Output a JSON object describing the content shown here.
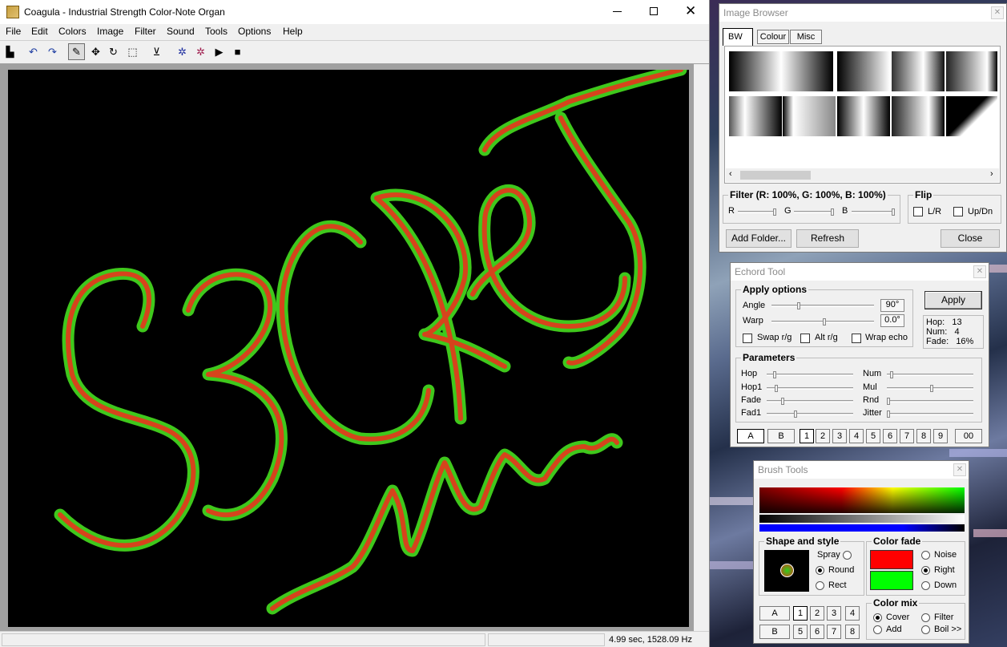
{
  "main_window": {
    "title": "Coagula - Industrial Strength Color-Note Organ",
    "menu": [
      "File",
      "Edit",
      "Colors",
      "Image",
      "Filter",
      "Sound",
      "Tools",
      "Options",
      "Help"
    ],
    "status_text": "4.99 sec, 1528.09 Hz",
    "canvas_text": "S3CRET"
  },
  "image_browser": {
    "title": "Image Browser",
    "tabs": [
      "BW",
      "Colour",
      "Misc"
    ],
    "filter_label": "Filter (R: 100%, G: 100%, B: 100%)",
    "filter_channels": [
      "R",
      "G",
      "B"
    ],
    "flip_label": "Flip",
    "flip_lr": "L/R",
    "flip_updn": "Up/Dn",
    "add_folder": "Add Folder...",
    "refresh": "Refresh",
    "close": "Close"
  },
  "echord_tool": {
    "title": "Echord Tool",
    "apply_options": "Apply options",
    "angle_label": "Angle",
    "angle_value": "90°",
    "warp_label": "Warp",
    "warp_value": "0.0°",
    "swap_rg": "Swap r/g",
    "alt_rg": "Alt r/g",
    "wrap_echo": "Wrap echo",
    "apply": "Apply",
    "info": {
      "hop_label": "Hop:",
      "hop": "13",
      "num_label": "Num:",
      "num": "4",
      "fade_label": "Fade:",
      "fade": "16%"
    },
    "parameters": "Parameters",
    "params_left": [
      "Hop",
      "Hop1",
      "Fade",
      "Fad1"
    ],
    "params_right": [
      "Num",
      "Mul",
      "Rnd",
      "Jitter"
    ],
    "presets": [
      "A",
      "B",
      "1",
      "2",
      "3",
      "4",
      "5",
      "6",
      "7",
      "8",
      "9",
      "00"
    ]
  },
  "brush_tools": {
    "title": "Brush Tools",
    "shape_style": "Shape and style",
    "spray": "Spray",
    "round": "Round",
    "rect": "Rect",
    "color_fade": "Color fade",
    "noise": "Noise",
    "right": "Right",
    "down": "Down",
    "color_mix": "Color mix",
    "cover": "Cover",
    "filter": "Filter",
    "add": "Add",
    "boil": "Boil >>",
    "row_a": [
      "A",
      "1",
      "2",
      "3",
      "4"
    ],
    "row_b": [
      "B",
      "5",
      "6",
      "7",
      "8"
    ],
    "fade_colors": {
      "from": "#ff0000",
      "to": "#00ff00"
    }
  }
}
